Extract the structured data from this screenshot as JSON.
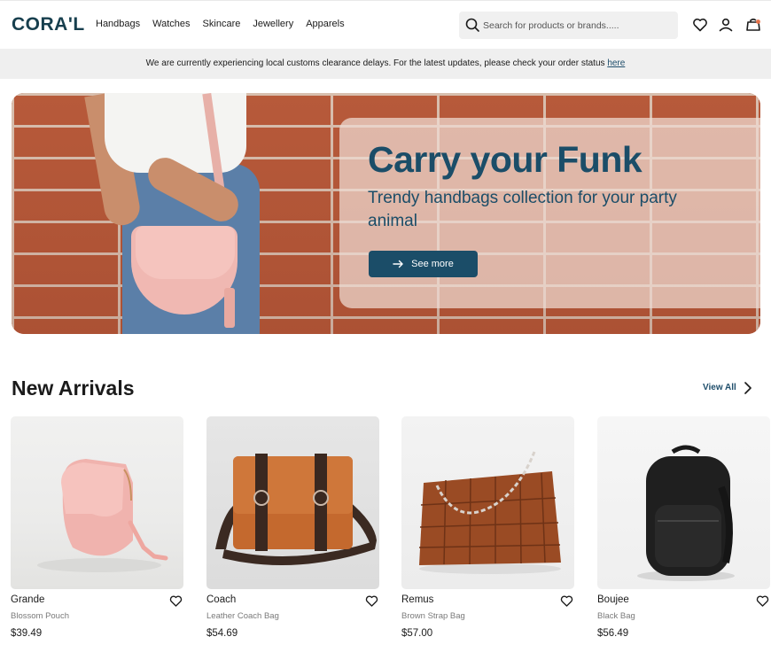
{
  "brand": {
    "logo": "CORA'L"
  },
  "nav": {
    "items": [
      "Handbags",
      "Watches",
      "Skincare",
      "Jewellery",
      "Apparels"
    ]
  },
  "search": {
    "placeholder": "Search for products or brands....."
  },
  "header_icons": [
    "heart-icon",
    "user-icon",
    "bag-icon"
  ],
  "notice": {
    "text": "We are currently experiencing local customs clearance delays. For the latest updates, please check your order status ",
    "link_label": "here"
  },
  "hero": {
    "title": "Carry your Funk",
    "subtitle": "Trendy handbags collection for your party animal",
    "button_label": "See more",
    "button_icon": "arrow-right-icon"
  },
  "new_arrivals": {
    "title": "New Arrivals",
    "view_all_label": "View All",
    "products": [
      {
        "name": "Grande",
        "description": "Blossom Pouch",
        "price": "$39.49"
      },
      {
        "name": "Coach",
        "description": "Leather Coach Bag",
        "price": "$54.69"
      },
      {
        "name": "Remus",
        "description": "Brown Strap Bag",
        "price": "$57.00"
      },
      {
        "name": "Boujee",
        "description": "Black Bag",
        "price": "$56.49"
      }
    ]
  },
  "colors": {
    "brand": "#173f4e",
    "accent": "#1b4d68",
    "cart_dot": "#e8734a",
    "notice_bg": "#efefef"
  }
}
